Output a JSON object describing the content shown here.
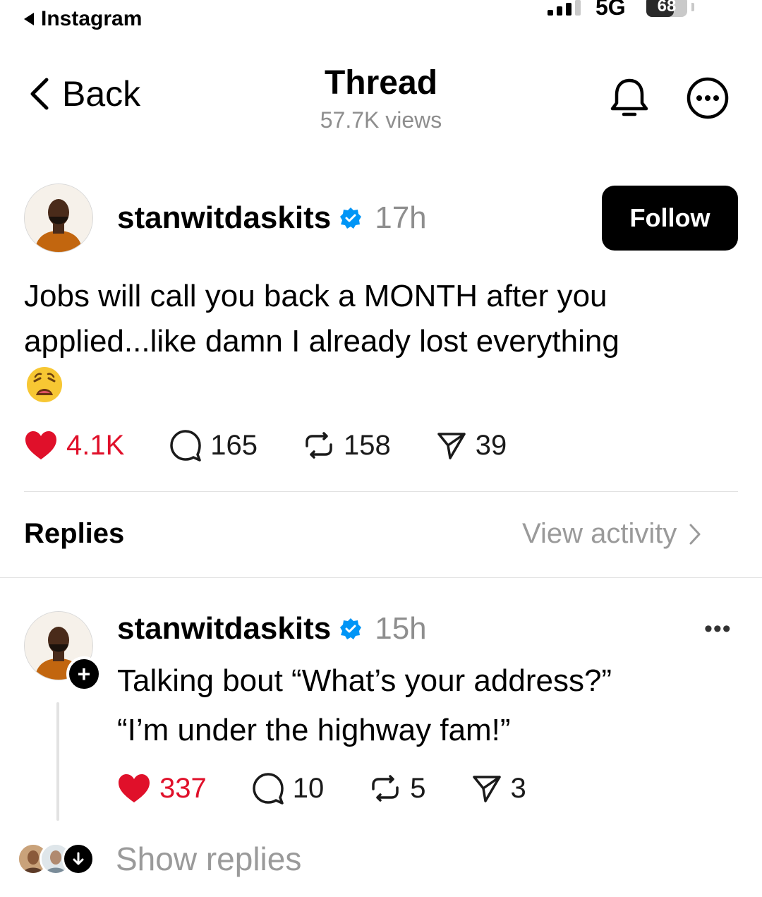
{
  "status_bar": {
    "back_app": "Instagram",
    "network": "5G",
    "battery": "68",
    "battery_level": 0.68
  },
  "header": {
    "back_label": "Back",
    "title": "Thread",
    "views": "57.7K views"
  },
  "post": {
    "username": "stanwitdaskits",
    "time": "17h",
    "follow_label": "Follow",
    "text": "Jobs will call you back a MONTH after you applied...like damn I already lost everything",
    "emoji": "😩",
    "likes": "4.1K",
    "comments": "165",
    "reposts": "158",
    "shares": "39"
  },
  "replies_section": {
    "label": "Replies",
    "view_activity": "View activity"
  },
  "reply": {
    "username": "stanwitdaskits",
    "time": "15h",
    "line1": "Talking bout “What’s your address?”",
    "line2": "“I’m under the highway fam!”",
    "likes": "337",
    "comments": "10",
    "reposts": "5",
    "shares": "3",
    "show_replies": "Show replies"
  },
  "colors": {
    "like_red": "#e0102a",
    "verified_blue": "#0095f6",
    "muted_gray": "#8e8e8e"
  },
  "icons": [
    "signal-icon",
    "battery-icon",
    "chevron-left-icon",
    "bell-icon",
    "more-circle-icon",
    "verified-badge-icon",
    "heart-icon",
    "comment-icon",
    "repost-icon",
    "share-icon",
    "chevron-right-icon",
    "plus-icon",
    "more-dots-icon",
    "arrow-down-icon"
  ]
}
